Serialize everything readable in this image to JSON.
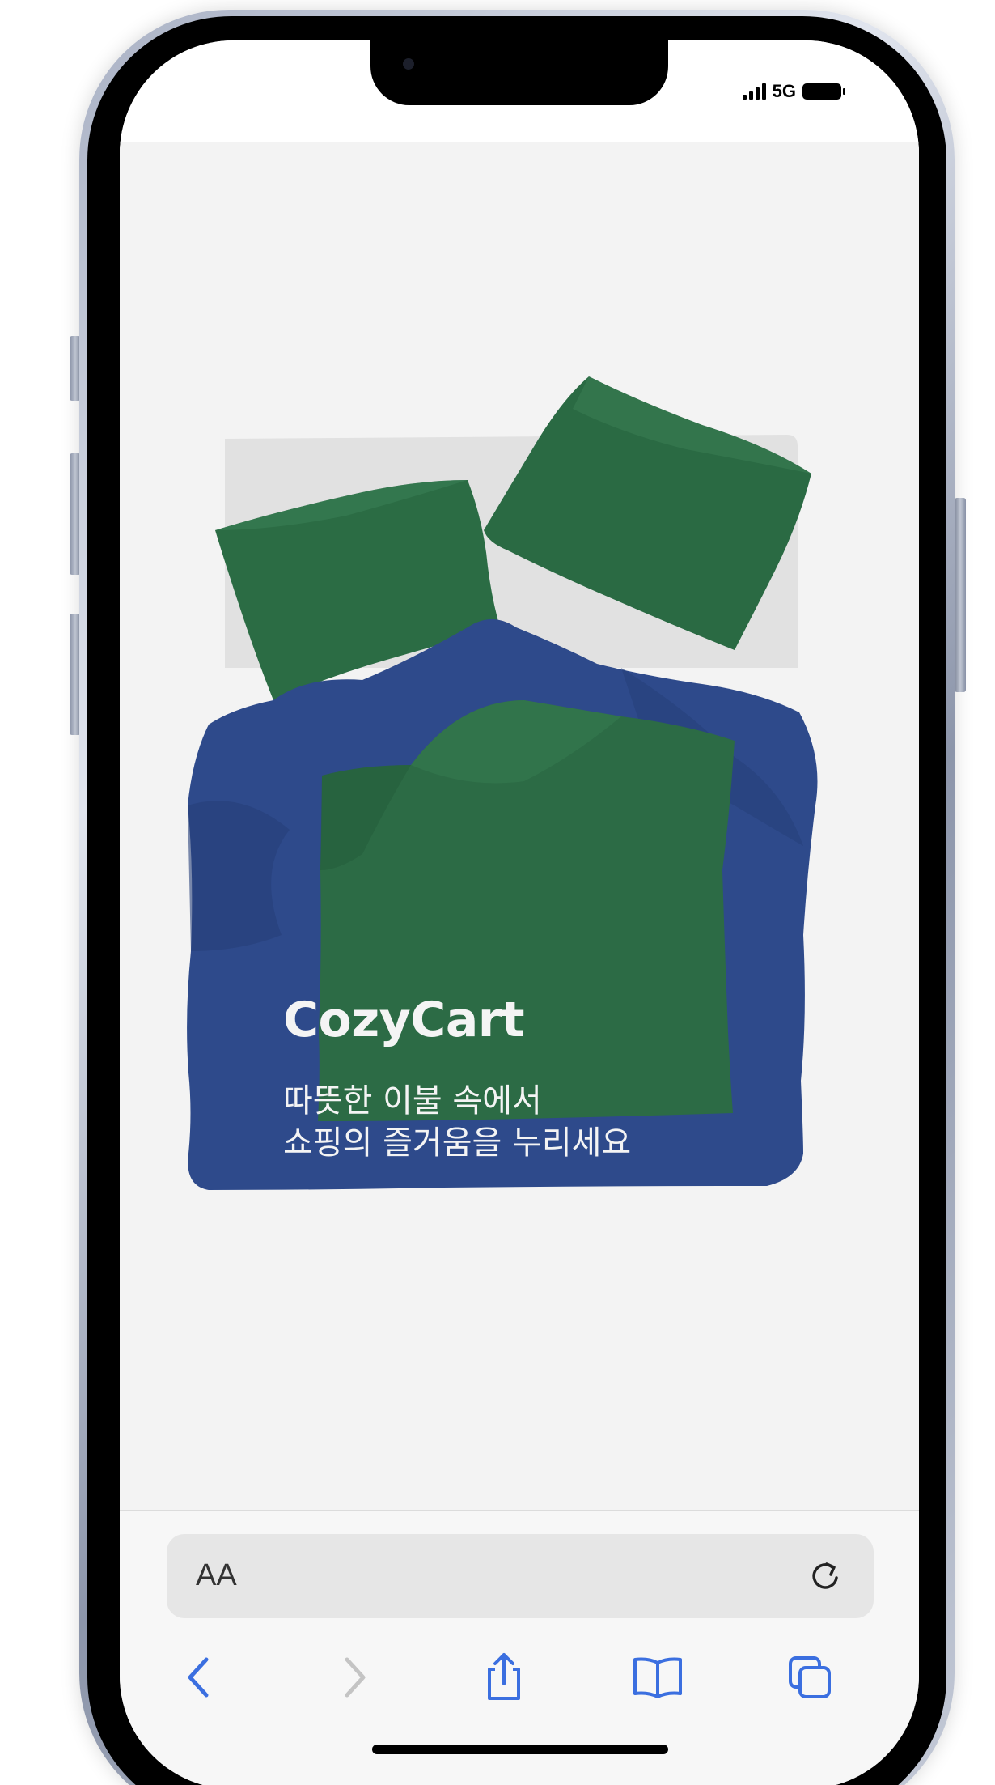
{
  "status_bar": {
    "network": "5G",
    "signal_bars": 4,
    "battery_level": 1.0
  },
  "hero": {
    "brand": "CozyCart",
    "tagline_line1": "따뜻한 이불 속에서",
    "tagline_line2": "쇼핑의 즐거움을 누리세요",
    "colors": {
      "background": "#f3f3f3",
      "sheet": "#e2e2e2",
      "pillow_green": "#2a6a43",
      "duvet_blue": "#2e4a8b",
      "duvet_center_green": "#2c6b45"
    }
  },
  "browser": {
    "text_size_label": "AA",
    "reload_icon": "reload-icon",
    "toolbar": [
      {
        "name": "back",
        "icon": "chevron-left-icon",
        "enabled": true
      },
      {
        "name": "forward",
        "icon": "chevron-right-icon",
        "enabled": false
      },
      {
        "name": "share",
        "icon": "share-icon",
        "enabled": true
      },
      {
        "name": "bookmarks",
        "icon": "book-icon",
        "enabled": true
      },
      {
        "name": "tabs",
        "icon": "tabs-icon",
        "enabled": true
      }
    ],
    "accent": "#3b6fe0"
  }
}
